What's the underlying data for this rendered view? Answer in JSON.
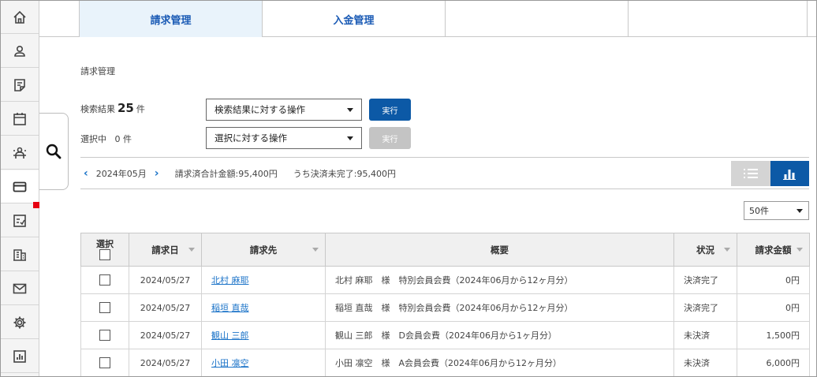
{
  "tabs": [
    {
      "label": "請求管理",
      "active": true
    },
    {
      "label": "入金管理",
      "active": false
    },
    {
      "label": "",
      "active": false
    },
    {
      "label": "",
      "active": false
    }
  ],
  "page_title": "請求管理",
  "search_result": {
    "prefix": "検索結果",
    "count": "25",
    "suffix": "件"
  },
  "selected": {
    "prefix": "選択中",
    "count": "0",
    "suffix": "件"
  },
  "actions": {
    "result_select": "検索結果に対する操作",
    "selection_select": "選択に対する操作",
    "run_label": "実行",
    "run_disabled_label": "実行"
  },
  "month_bar": {
    "month": "2024年05月",
    "billed_total": "請求済合計金額:95,400円",
    "unsettled": "うち決済未完了:95,400円"
  },
  "per_page": "50件",
  "table": {
    "headers": {
      "select": "選択",
      "date": "請求日",
      "customer": "請求先",
      "summary": "概要",
      "status": "状況",
      "amount": "請求金額"
    },
    "rows": [
      {
        "date": "2024/05/27",
        "customer": "北村 麻耶",
        "summary": "北村 麻耶　様　特別会員会費（2024年06月から12ヶ月分）",
        "status": "決済完了",
        "amount": "0円"
      },
      {
        "date": "2024/05/27",
        "customer": "稲垣 直哉",
        "summary": "稲垣 直哉　様　特別会員会費（2024年06月から12ヶ月分）",
        "status": "決済完了",
        "amount": "0円"
      },
      {
        "date": "2024/05/27",
        "customer": "観山 三郎",
        "summary": "観山 三郎　様　D会員会費（2024年06月から1ヶ月分）",
        "status": "未決済",
        "amount": "1,500円"
      },
      {
        "date": "2024/05/27",
        "customer": "小田 凛空",
        "summary": "小田 凛空　様　A会員会費（2024年06月から12ヶ月分）",
        "status": "未決済",
        "amount": "6,000円"
      }
    ]
  },
  "rail_icons": [
    "home-icon",
    "user-icon",
    "note-icon",
    "calendar-icon",
    "reception-icon",
    "card-icon",
    "checklist-icon",
    "building-icon",
    "mail-icon",
    "gear-icon",
    "report-icon"
  ],
  "colors": {
    "accent": "#0c59a6",
    "tab_text": "#1b5bb5",
    "link": "#1b73c8",
    "badge": "#e60012"
  }
}
